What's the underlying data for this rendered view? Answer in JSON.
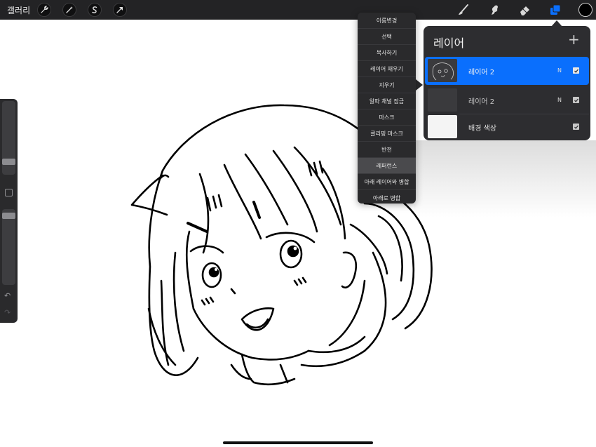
{
  "topbar": {
    "gallery_label": "갤러리",
    "left_icons": [
      "wrench-icon",
      "magic-wand-icon",
      "selection-icon",
      "transform-arrow-icon"
    ],
    "tools": [
      "brush-icon",
      "smudge-icon",
      "eraser-icon",
      "layers-icon"
    ],
    "active_tool": "layers",
    "current_color": "#000000",
    "accent_color": "#0a6ffd"
  },
  "sidebar": {
    "brush_size_level": 0.26,
    "opacity_level": 0.07,
    "undo_icon": "undo-icon",
    "redo_icon": "redo-icon"
  },
  "context_menu": {
    "items": [
      "이름변경",
      "선택",
      "복사하기",
      "레이어 채우기",
      "지우기",
      "알파 채널 잠금",
      "마스크",
      "클리핑 마스크",
      "반전",
      "레퍼런스",
      "아래 레이어와 병합",
      "아래로 병합"
    ],
    "highlighted": "레퍼런스"
  },
  "layers_panel": {
    "title": "레이어",
    "add_icon": "plus-icon",
    "layers": [
      {
        "name": "레이어 2",
        "mode": "N",
        "visible": true,
        "selected": true
      },
      {
        "name": "레이어 2",
        "mode": "N",
        "visible": true,
        "selected": false
      },
      {
        "name": "배경 색상",
        "mode": "",
        "visible": true,
        "selected": false
      }
    ]
  }
}
